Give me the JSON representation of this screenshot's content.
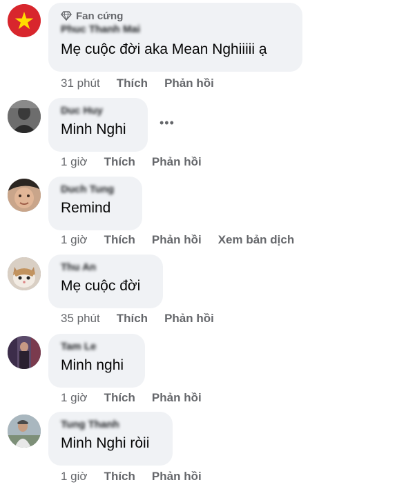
{
  "comments": [
    {
      "badge": "Fan cứng",
      "author": "Phuc Thanh Mai",
      "text": "Mẹ cuộc đời aka Mean Nghiiiii ạ",
      "time": "31 phút",
      "like": "Thích",
      "reply": "Phản hồi"
    },
    {
      "author": "Duc Huy",
      "text": "Minh Nghi",
      "time": "1 giờ",
      "like": "Thích",
      "reply": "Phản hồi",
      "more": "•••"
    },
    {
      "author": "Duch Tung",
      "text": "Remind",
      "time": "1 giờ",
      "like": "Thích",
      "reply": "Phản hồi",
      "translate": "Xem bản dịch"
    },
    {
      "author": "Thu An",
      "text": "Mẹ cuộc đời",
      "time": "35 phút",
      "like": "Thích",
      "reply": "Phản hồi"
    },
    {
      "author": "Tam Le",
      "text": "Minh nghi",
      "time": "1 giờ",
      "like": "Thích",
      "reply": "Phản hồi"
    },
    {
      "author": "Tung Thanh",
      "text": "Minh Nghi ròii",
      "time": "1 giờ",
      "like": "Thích",
      "reply": "Phản hồi"
    }
  ]
}
